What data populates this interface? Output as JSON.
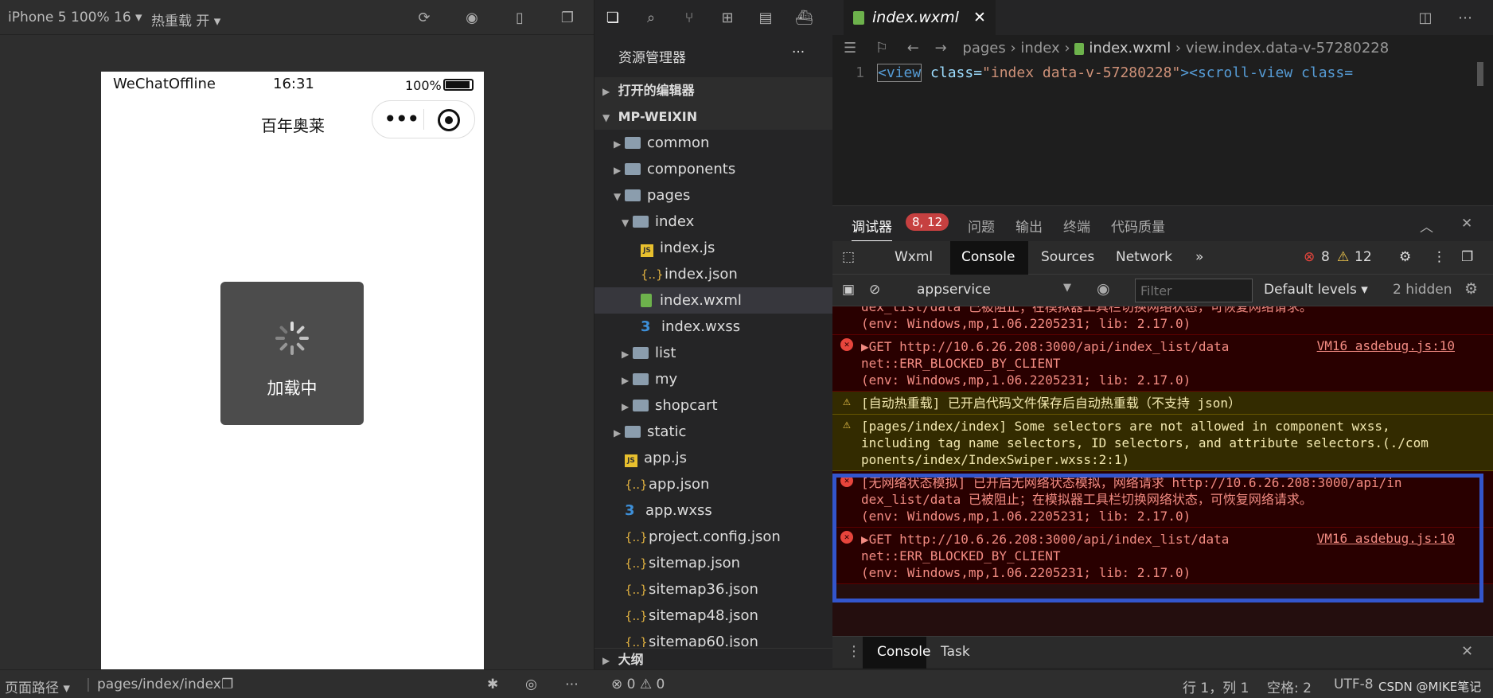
{
  "simulator": {
    "device": "iPhone 5 100% 16 ▾",
    "hot_reload": "热重载 开 ▾",
    "status_carrier": "WeChatOffline",
    "status_time": "16:31",
    "status_battery": "100%",
    "nav_title": "百年奥莱",
    "loading_text": "加载中",
    "footer_path_label": "页面路径 ▾",
    "footer_path": "pages/index/index"
  },
  "explorer": {
    "title": "资源管理器",
    "more": "···",
    "open_editors": "打开的编辑器",
    "project": "MP-WEIXIN",
    "items": [
      {
        "label": "common",
        "type": "folder",
        "depth": 1,
        "caret": "▶"
      },
      {
        "label": "components",
        "type": "folder",
        "depth": 1,
        "caret": "▶"
      },
      {
        "label": "pages",
        "type": "folder",
        "depth": 1,
        "caret": "▼"
      },
      {
        "label": "index",
        "type": "folder",
        "depth": 2,
        "caret": "▼"
      },
      {
        "label": "index.js",
        "type": "js",
        "depth": 3,
        "caret": ""
      },
      {
        "label": "index.json",
        "type": "json",
        "depth": 3,
        "caret": ""
      },
      {
        "label": "index.wxml",
        "type": "wxml",
        "depth": 3,
        "caret": ""
      },
      {
        "label": "index.wxss",
        "type": "css",
        "depth": 3,
        "caret": ""
      },
      {
        "label": "list",
        "type": "folder",
        "depth": 2,
        "caret": "▶"
      },
      {
        "label": "my",
        "type": "folder",
        "depth": 2,
        "caret": "▶"
      },
      {
        "label": "shopcart",
        "type": "folder",
        "depth": 2,
        "caret": "▶"
      },
      {
        "label": "static",
        "type": "folder",
        "depth": 1,
        "caret": "▶"
      },
      {
        "label": "app.js",
        "type": "js",
        "depth": 1,
        "caret": ""
      },
      {
        "label": "app.json",
        "type": "json",
        "depth": 1,
        "caret": ""
      },
      {
        "label": "app.wxss",
        "type": "css",
        "depth": 1,
        "caret": ""
      },
      {
        "label": "project.config.json",
        "type": "json",
        "depth": 1,
        "caret": ""
      },
      {
        "label": "sitemap.json",
        "type": "json",
        "depth": 1,
        "caret": ""
      },
      {
        "label": "sitemap36.json",
        "type": "json",
        "depth": 1,
        "caret": ""
      },
      {
        "label": "sitemap48.json",
        "type": "json",
        "depth": 1,
        "caret": ""
      },
      {
        "label": "sitemap60.json",
        "type": "json",
        "depth": 1,
        "caret": ""
      }
    ],
    "outline": "大纲",
    "problems_count": "⊗ 0 ⚠ 0"
  },
  "editor": {
    "tab": "index.wxml",
    "breadcrumb": [
      "pages",
      "index",
      "index.wxml",
      "view.index.data-v-57280228"
    ],
    "line_number": "1",
    "code_tag": "<view",
    "code_attr": " class=",
    "code_value": "\"index data-v-57280228\"",
    "code_rest": "><scroll-view class="
  },
  "devtools": {
    "tabs_top": [
      "调试器",
      "问题",
      "输出",
      "终端",
      "代码质量"
    ],
    "debugger_badge": "8, 12",
    "panel_tabs": [
      "Wxml",
      "Console",
      "Sources",
      "Network"
    ],
    "err_count": "8",
    "warn_count": "12",
    "context": "appservice",
    "filter_placeholder": "Filter",
    "levels": "Default levels ▾",
    "hidden": "2 hidden",
    "drawer_tabs": [
      "Console",
      "Task"
    ],
    "messages": [
      {
        "kind": "err",
        "lines": [
          "dex_list/data 已被阻止；在模拟器工具栏切换网络状态，可恢复网络请求。",
          "(env: Windows,mp,1.06.2205231; lib: 2.17.0)"
        ]
      },
      {
        "kind": "err",
        "lines": [
          "▶GET http://10.6.26.208:3000/api/index_list/data",
          "net::ERR_BLOCKED_BY_CLIENT",
          "(env: Windows,mp,1.06.2205231; lib: 2.17.0)"
        ],
        "src": "VM16 asdebug.js:10"
      },
      {
        "kind": "warn",
        "lines": [
          "[自动热重载] 已开启代码文件保存后自动热重载（不支持 json）"
        ]
      },
      {
        "kind": "warn",
        "lines": [
          "[pages/index/index] Some selectors are not allowed in component wxss,",
          "including tag name selectors, ID selectors, and attribute selectors.(./com",
          "ponents/index/IndexSwiper.wxss:2:1)"
        ]
      },
      {
        "kind": "err",
        "lines": [
          "[无网络状态模拟] 已开启无网络状态模拟，网络请求 http://10.6.26.208:3000/api/in",
          "dex_list/data 已被阻止；在模拟器工具栏切换网络状态，可恢复网络请求。",
          "(env: Windows,mp,1.06.2205231; lib: 2.17.0)"
        ]
      },
      {
        "kind": "err",
        "lines": [
          "▶GET http://10.6.26.208:3000/api/index_list/data",
          "net::ERR_BLOCKED_BY_CLIENT",
          "(env: Windows,mp,1.06.2205231; lib: 2.17.0)"
        ],
        "src": "VM16 asdebug.js:10"
      }
    ]
  },
  "statusbar": {
    "position": "行 1，列 1",
    "spaces": "空格: 2",
    "encoding": "UTF-8",
    "watermark": "CSDN @MIKE笔记"
  }
}
